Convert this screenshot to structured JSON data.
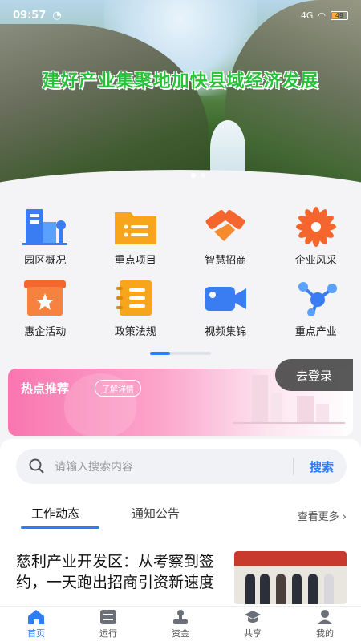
{
  "status_bar": {
    "time": "09:57",
    "signal": "4G",
    "battery": "49"
  },
  "hero": {
    "headline": "建好产业集聚地加快县域经济发展"
  },
  "grid": [
    {
      "label": "园区概况",
      "icon": "building-icon"
    },
    {
      "label": "重点项目",
      "icon": "folder-list-icon"
    },
    {
      "label": "智慧招商",
      "icon": "handshake-icon"
    },
    {
      "label": "企业风采",
      "icon": "flower-icon"
    },
    {
      "label": "惠企活动",
      "icon": "star-ticket-icon"
    },
    {
      "label": "政策法规",
      "icon": "notebook-icon"
    },
    {
      "label": "视频集锦",
      "icon": "video-camera-icon"
    },
    {
      "label": "重点产业",
      "icon": "network-icon"
    }
  ],
  "hot": {
    "title": "热点推荐",
    "chip": "了解详情"
  },
  "login_button": "去登录",
  "search": {
    "placeholder": "请输入搜索内容",
    "button": "搜索"
  },
  "tabs": {
    "active": "工作动态",
    "other": "通知公告",
    "more": "查看更多"
  },
  "news": {
    "title": "慈利产业开发区：从考察到签约，一天跑出招商引资新速度"
  },
  "nav": [
    {
      "label": "首页",
      "icon": "home-icon"
    },
    {
      "label": "运行",
      "icon": "sliders-icon"
    },
    {
      "label": "资金",
      "icon": "stamp-icon"
    },
    {
      "label": "共享",
      "icon": "graduation-cap-icon"
    },
    {
      "label": "我的",
      "icon": "user-icon"
    }
  ],
  "colors": {
    "accent": "#2e7df6",
    "headline": "#27c13a",
    "hot": "#f976b0"
  }
}
